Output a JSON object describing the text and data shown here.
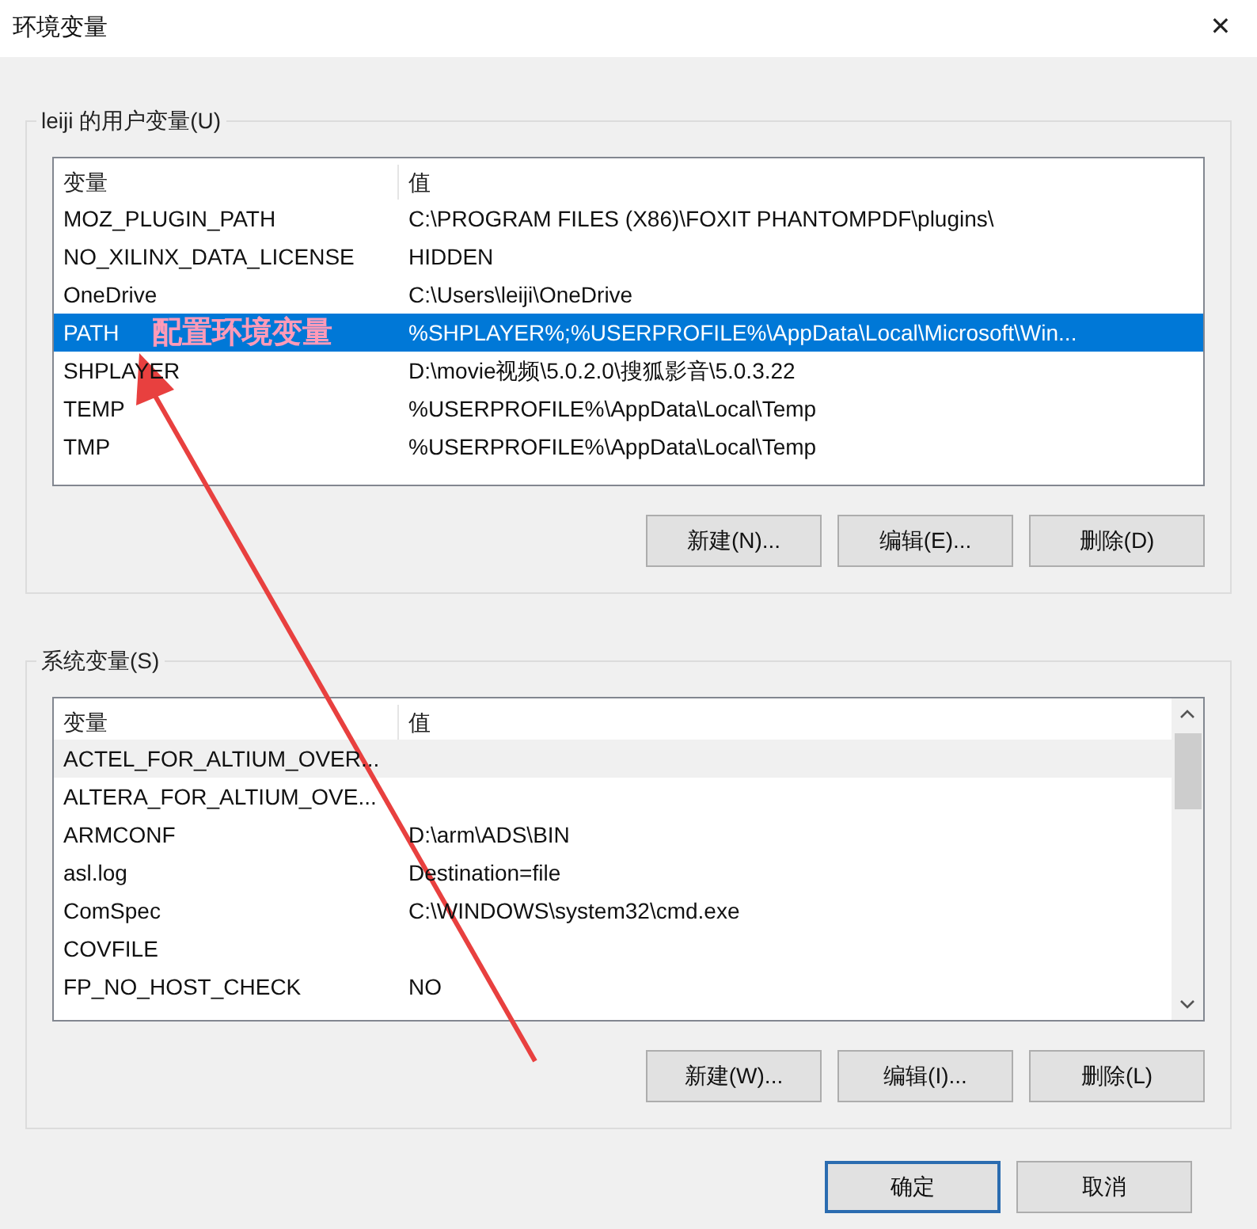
{
  "window": {
    "title": "环境变量",
    "close": "✕"
  },
  "user_vars": {
    "label": "leiji 的用户变量(U)",
    "columns": [
      "变量",
      "值"
    ],
    "rows": [
      {
        "name": "MOZ_PLUGIN_PATH",
        "value": "C:\\PROGRAM FILES (X86)\\FOXIT PHANTOMPDF\\plugins\\",
        "selected": false
      },
      {
        "name": "NO_XILINX_DATA_LICENSE",
        "value": "HIDDEN",
        "selected": false
      },
      {
        "name": "OneDrive",
        "value": "C:\\Users\\leiji\\OneDrive",
        "selected": false
      },
      {
        "name": "PATH",
        "value": "%SHPLAYER%;%USERPROFILE%\\AppData\\Local\\Microsoft\\Win...",
        "selected": true
      },
      {
        "name": "SHPLAYER",
        "value": "D:\\movie视频\\5.0.2.0\\搜狐影音\\5.0.3.22",
        "selected": false
      },
      {
        "name": "TEMP",
        "value": "%USERPROFILE%\\AppData\\Local\\Temp",
        "selected": false
      },
      {
        "name": "TMP",
        "value": "%USERPROFILE%\\AppData\\Local\\Temp",
        "selected": false
      }
    ],
    "buttons": [
      "新建(N)...",
      "编辑(E)...",
      "删除(D)"
    ]
  },
  "system_vars": {
    "label": "系统变量(S)",
    "columns": [
      "变量",
      "值"
    ],
    "rows": [
      {
        "name": "ACTEL_FOR_ALTIUM_OVER...",
        "value": "",
        "selected": false,
        "hovered": true
      },
      {
        "name": "ALTERA_FOR_ALTIUM_OVE...",
        "value": "",
        "selected": false,
        "hovered": false
      },
      {
        "name": "ARMCONF",
        "value": "D:\\arm\\ADS\\BIN",
        "selected": false,
        "hovered": false
      },
      {
        "name": "asl.log",
        "value": "Destination=file",
        "selected": false,
        "hovered": false
      },
      {
        "name": "ComSpec",
        "value": "C:\\WINDOWS\\system32\\cmd.exe",
        "selected": false,
        "hovered": false
      },
      {
        "name": "COVFILE",
        "value": "",
        "selected": false,
        "hovered": false
      },
      {
        "name": "FP_NO_HOST_CHECK",
        "value": "NO",
        "selected": false,
        "hovered": false
      }
    ],
    "buttons": [
      "新建(W)...",
      "编辑(I)...",
      "删除(L)"
    ]
  },
  "footer_buttons": [
    {
      "label": "确定",
      "default": true
    },
    {
      "label": "取消",
      "default": false
    }
  ],
  "annotation": {
    "text": "配置环境变量"
  }
}
